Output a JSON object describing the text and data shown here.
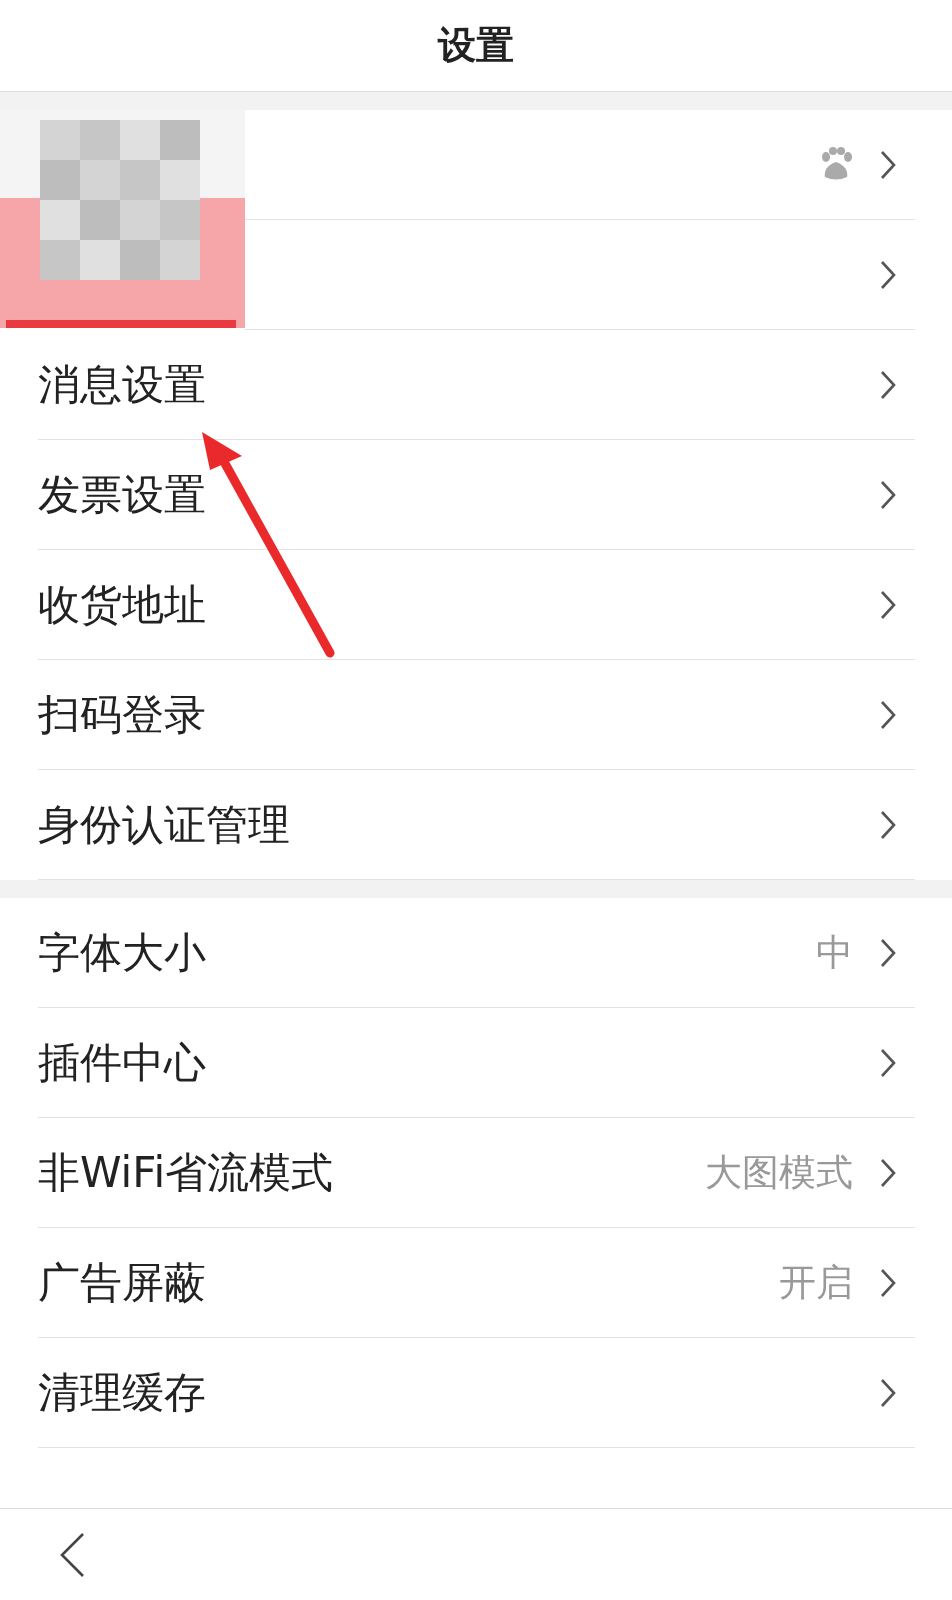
{
  "title": "设置",
  "account_rows": [
    {
      "badge": true
    },
    {
      "badge": false
    }
  ],
  "sections": [
    {
      "items": [
        {
          "label": "消息设置"
        },
        {
          "label": "发票设置"
        },
        {
          "label": "收货地址"
        },
        {
          "label": "扫码登录"
        },
        {
          "label": "身份认证管理"
        }
      ]
    },
    {
      "items": [
        {
          "label": "字体大小",
          "value": "中"
        },
        {
          "label": "插件中心"
        },
        {
          "label": "非WiFi省流模式",
          "value": "大图模式"
        },
        {
          "label": "广告屏蔽",
          "value": "开启"
        },
        {
          "label": "清理缓存"
        }
      ]
    }
  ],
  "annotation": {
    "kind": "arrow"
  }
}
